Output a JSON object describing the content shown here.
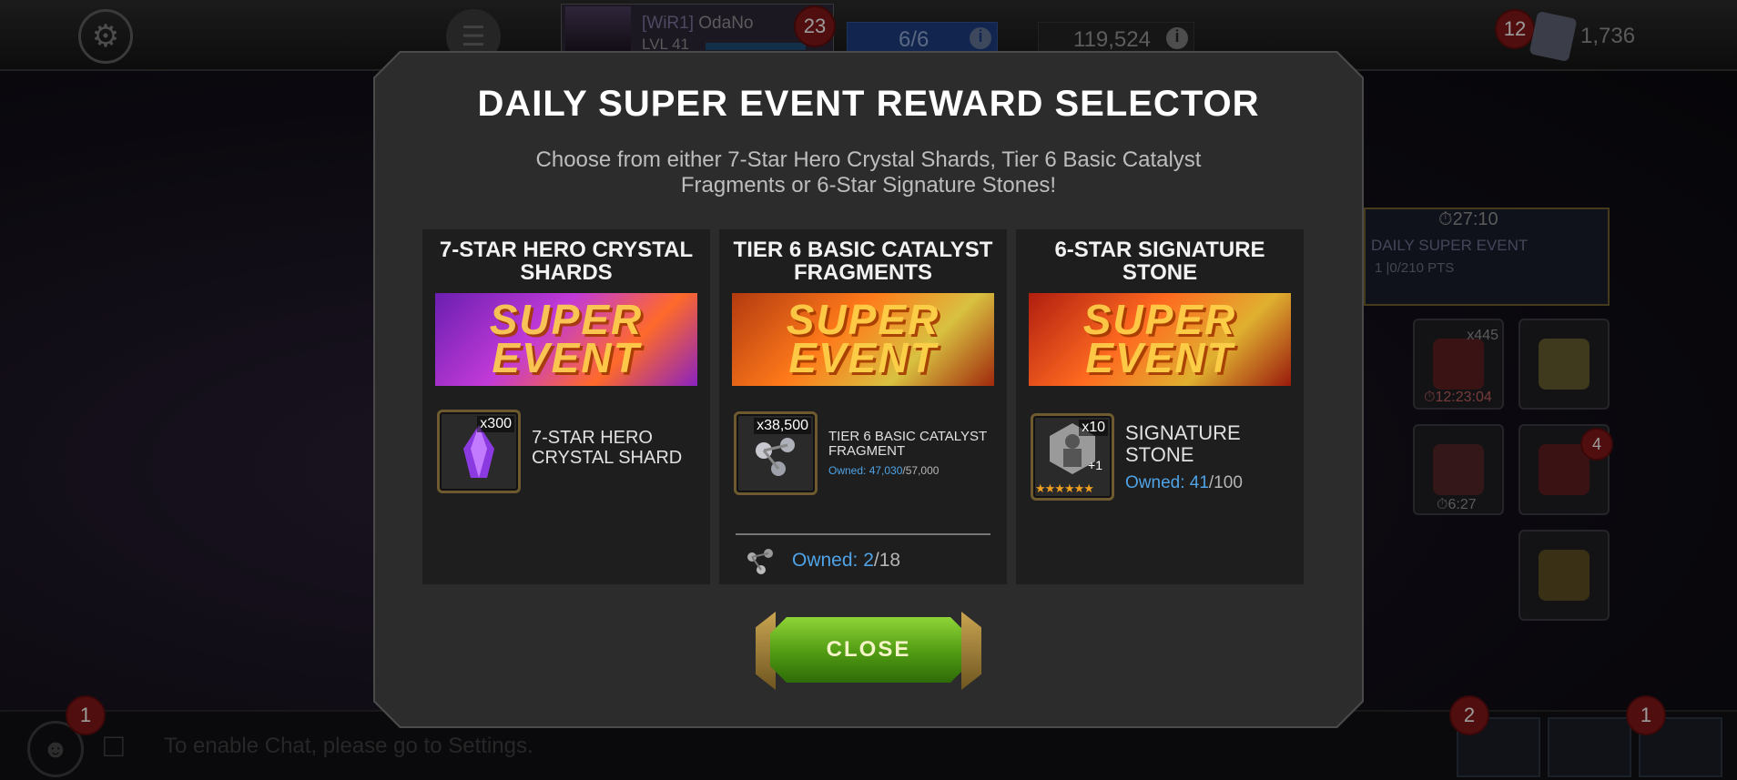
{
  "hud": {
    "player_alliance": "[WiR1]",
    "player_name": "OdaNo",
    "player_level": "LVL 41",
    "notifications_count": "23",
    "energy": "6/6",
    "units": "119,524",
    "gold_badge": "12",
    "gold": "1,736",
    "info_glyph": "i",
    "gear_glyph": "⚙",
    "menu_glyph": "☰"
  },
  "side": {
    "event_timer": "⏱27:10",
    "event_name": "DAILY SUPER EVENT",
    "event_points": "1 |0/210 PTS",
    "loot_count": "x445",
    "loot_timer": "⏱12:23:04",
    "calendar_timer": "⏱6:27",
    "shield_badge": "4"
  },
  "bottom": {
    "chat_badge": "1",
    "chat_hint": "To enable Chat, please go to Settings.",
    "quest_badge": "2",
    "check_badge": "1"
  },
  "modal": {
    "title": "DAILY SUPER EVENT REWARD SELECTOR",
    "description": "Choose from either 7-Star Hero Crystal Shards, Tier 6 Basic Catalyst Fragments or 6-Star Signature Stones!",
    "banner_text": "SUPER EVENT",
    "close_label": "CLOSE",
    "options": [
      {
        "title": "7-STAR HERO CRYSTAL SHARDS",
        "item_count": "x300",
        "item_name": "7-STAR HERO CRYSTAL SHARD",
        "icon": "purple-crystal-shard-icon"
      },
      {
        "title": "TIER 6 BASIC CATALYST FRAGMENTS",
        "item_count": "x38,500",
        "item_name": "TIER 6 BASIC CATALYST FRAGMENT",
        "owned_label": "Owned:",
        "owned_value": "47,030",
        "owned_max": "/57,000",
        "footer_owned_label": "Owned:",
        "footer_owned_value": "2",
        "footer_owned_max": "/18",
        "icon": "catalyst-fragment-icon"
      },
      {
        "title": "6-STAR SIGNATURE STONE",
        "item_count": "x10",
        "item_plus": "+1",
        "item_name": "SIGNATURE STONE",
        "owned_label": "Owned:",
        "owned_value": "41",
        "owned_max": "/100",
        "stars": "★★★★★★",
        "icon": "signature-stone-icon"
      }
    ]
  },
  "colors": {
    "accent_blue": "#4fa3e6",
    "close_green": "#4f9a12",
    "modal_bg": "#2c2c2c",
    "panel_bg": "#1e1e1e"
  }
}
